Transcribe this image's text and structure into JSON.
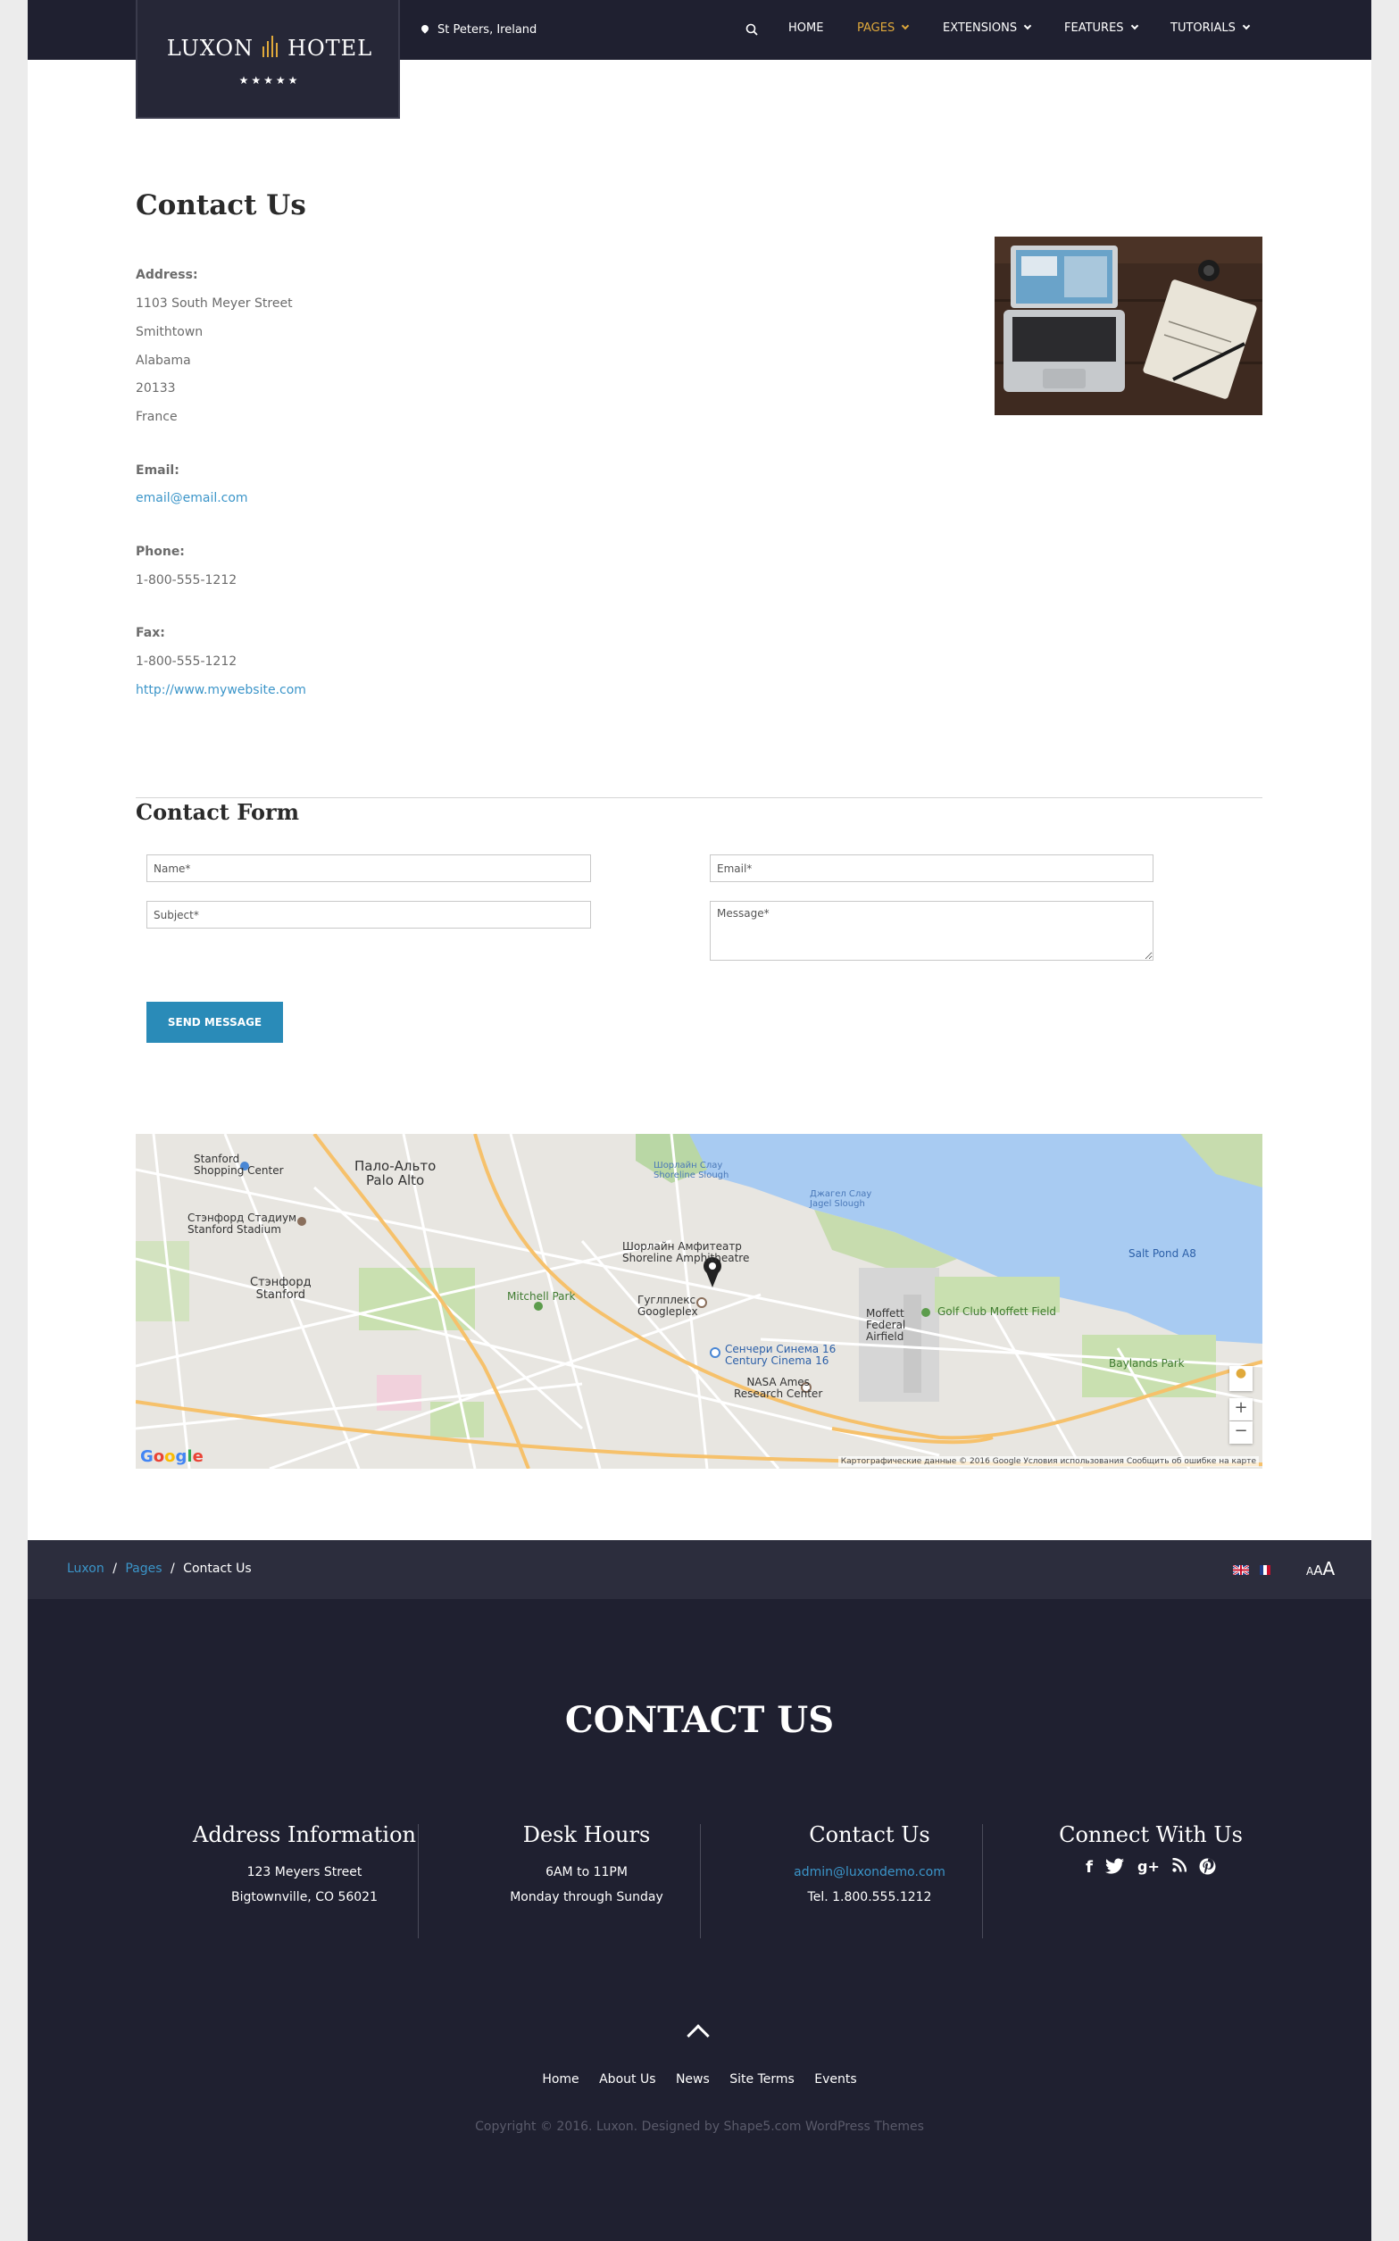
{
  "brand": {
    "name_left": "LUXON",
    "name_right": "HOTEL",
    "stars": "★★★★★",
    "accent": "#e0a93b"
  },
  "header": {
    "location": "St Peters, Ireland",
    "nav": [
      "HOME",
      "PAGES",
      "EXTENSIONS",
      "FEATURES",
      "TUTORIALS"
    ],
    "active_nav": "PAGES"
  },
  "main": {
    "title": "Contact Us",
    "address_label": "Address:",
    "address_lines": [
      "1103 South Meyer Street",
      "Smithtown",
      "Alabama",
      "20133",
      "France"
    ],
    "email_label": "Email:",
    "email": "email@email.com",
    "phone_label": "Phone:",
    "phone": "1-800-555-1212",
    "fax_label": "Fax:",
    "fax": "1-800-555-1212",
    "website": "http://www.mywebsite.com"
  },
  "form": {
    "title": "Contact Form",
    "name_placeholder": "Name*",
    "email_placeholder": "Email*",
    "subject_placeholder": "Subject*",
    "message_placeholder": "Message*",
    "send_label": "SEND MESSAGE",
    "button_color": "#2a8bb8"
  },
  "map": {
    "labels": {
      "stanford_sc": "Stanford\nShopping Center",
      "palo_alto": "Пало-Альто\nPalo Alto",
      "stanford_stadium": "Стэнфорд Стадиум\nStanford Stadium",
      "stanford": "Стэнфорд\nStanford",
      "mitchell_park": "Mitchell Park",
      "shoreline": "Шорлайн Амфитеатр\nShoreline Amphitheatre",
      "googleplex": "Гуглплекс\nGoogleplex",
      "century": "Сенчери Синема 16\nCentury Cinema 16",
      "nasa": "NASA Ames\nResearch Center",
      "moffett": "Moffett\nFederal\nAirfield",
      "golf": "Golf Club Moffett Field",
      "baylands": "Baylands Park",
      "salt_pond": "Salt Pond A8",
      "shoreline_slough": "Шорлайн Слау\nShoreline Slough",
      "jagel": "Джагел Слау\nJagel Slough"
    },
    "google": "Google",
    "credit": "Картографические данные © 2016 Google   Условия использования   Сообщить об ошибке на карте",
    "zoom_in": "+",
    "zoom_out": "−"
  },
  "breadcrumb": {
    "items": [
      "Luxon",
      "Pages"
    ],
    "current": "Contact Us",
    "sep": "/",
    "font_tool": "AAA"
  },
  "footer": {
    "title": "CONTACT US",
    "columns": [
      {
        "heading": "Address Information",
        "line1": "123 Meyers Street",
        "line2": "Bigtownville, CO 56021"
      },
      {
        "heading": "Desk Hours",
        "line1": "6AM to 11PM",
        "line2": "Monday through Sunday"
      },
      {
        "heading": "Contact Us",
        "line1": "admin@luxondemo.com",
        "line2": "Tel. 1.800.555.1212"
      },
      {
        "heading": "Connect With Us"
      }
    ],
    "social": [
      "f",
      "t",
      "g+",
      "rss",
      "p"
    ],
    "links": [
      "Home",
      "About Us",
      "News",
      "Site Terms",
      "Events"
    ],
    "copyright": "Copyright © 2016. Luxon. Designed by Shape5.com WordPress Themes"
  }
}
